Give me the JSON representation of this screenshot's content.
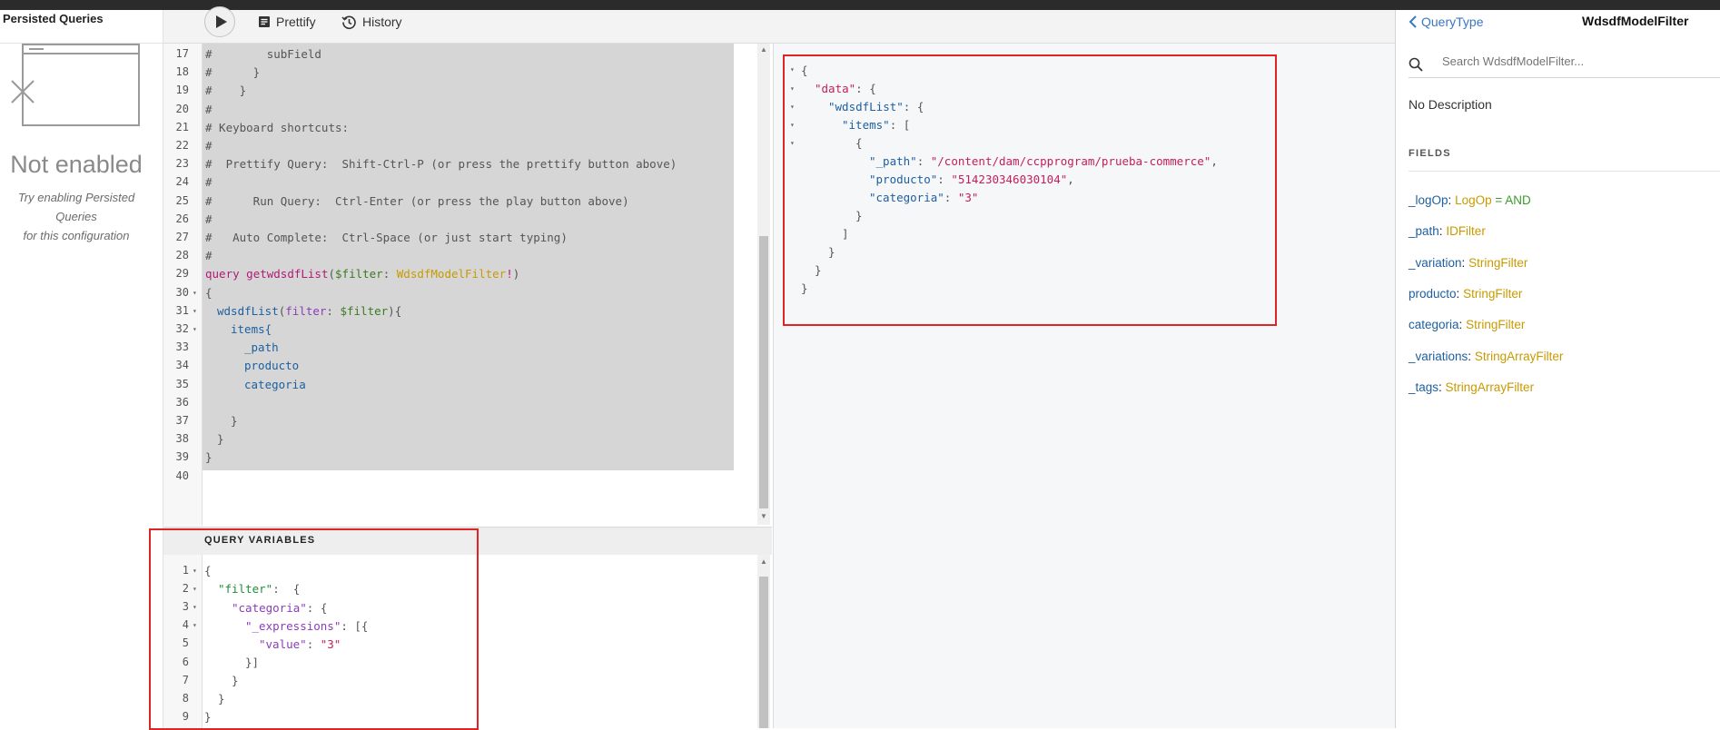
{
  "left_panel": {
    "title": "Persisted Queries",
    "status_title": "Not enabled",
    "status_desc_line1": "Try enabling Persisted Queries",
    "status_desc_line2": "for this configuration"
  },
  "toolbar": {
    "prettify_label": "Prettify",
    "history_label": "History"
  },
  "query_editor": {
    "lines": [
      {
        "n": "17",
        "text": "#        subField"
      },
      {
        "n": "18",
        "text": "#      }"
      },
      {
        "n": "19",
        "text": "#    }"
      },
      {
        "n": "20",
        "text": "#"
      },
      {
        "n": "21",
        "text": "# Keyboard shortcuts:"
      },
      {
        "n": "22",
        "text": "#"
      },
      {
        "n": "23",
        "text": "#  Prettify Query:  Shift-Ctrl-P (or press the prettify button above)"
      },
      {
        "n": "24",
        "text": "#"
      },
      {
        "n": "25",
        "text": "#      Run Query:  Ctrl-Enter (or press the play button above)"
      },
      {
        "n": "26",
        "text": "#"
      },
      {
        "n": "27",
        "text": "#   Auto Complete:  Ctrl-Space (or just start typing)"
      },
      {
        "n": "28",
        "text": "#"
      },
      {
        "n": "29",
        "kw": "query",
        "name": "getwdsdfList",
        "varname": "$filter",
        "type": "WdsdfModelFilter"
      },
      {
        "n": "30",
        "text": "{"
      },
      {
        "n": "31",
        "field": "wdsdfList",
        "arg": "filter",
        "argval": "$filter"
      },
      {
        "n": "32",
        "text": "items{"
      },
      {
        "n": "33",
        "text": "_path"
      },
      {
        "n": "34",
        "text": "producto"
      },
      {
        "n": "35",
        "text": "categoria"
      },
      {
        "n": "36",
        "text": ""
      },
      {
        "n": "37",
        "text": "}"
      },
      {
        "n": "38",
        "text": "}"
      },
      {
        "n": "39",
        "text": "}"
      },
      {
        "n": "40",
        "text": ""
      }
    ]
  },
  "variables": {
    "title": "QUERY VARIABLES",
    "lines": [
      "1",
      "2",
      "3",
      "4",
      "5",
      "6",
      "7",
      "8",
      "9"
    ],
    "filter_key": "\"filter\"",
    "categoria_key": "\"categoria\"",
    "expressions_key": "\"_expressions\"",
    "value_key": "\"value\"",
    "value_val": "\"3\""
  },
  "result": {
    "data_key": "\"data\"",
    "list_key": "\"wdsdfList\"",
    "items_key": "\"items\"",
    "path_key": "\"_path\"",
    "path_val": "\"/content/dam/ccpprogram/prueba-commerce\"",
    "producto_key": "\"producto\"",
    "producto_val": "\"514230346030104\"",
    "categoria_key": "\"categoria\"",
    "categoria_val": "\"3\""
  },
  "docs": {
    "back_label": "QueryType",
    "title": "WdsdfModelFilter",
    "search_placeholder": "Search WdsdfModelFilter...",
    "description": "No Description",
    "fields_header": "FIELDS",
    "fields": [
      {
        "name": "_logOp",
        "type": "LogOp",
        "default": "= AND"
      },
      {
        "name": "_path",
        "type": "IDFilter"
      },
      {
        "name": "_variation",
        "type": "StringFilter"
      },
      {
        "name": "producto",
        "type": "StringFilter"
      },
      {
        "name": "categoria",
        "type": "StringFilter"
      },
      {
        "name": "_variations",
        "type": "StringArrayFilter"
      },
      {
        "name": "_tags",
        "type": "StringArrayFilter"
      }
    ]
  },
  "colors": {
    "highlight_box": "#e02424",
    "link": "#3a76c4",
    "type": "#c89a00"
  }
}
